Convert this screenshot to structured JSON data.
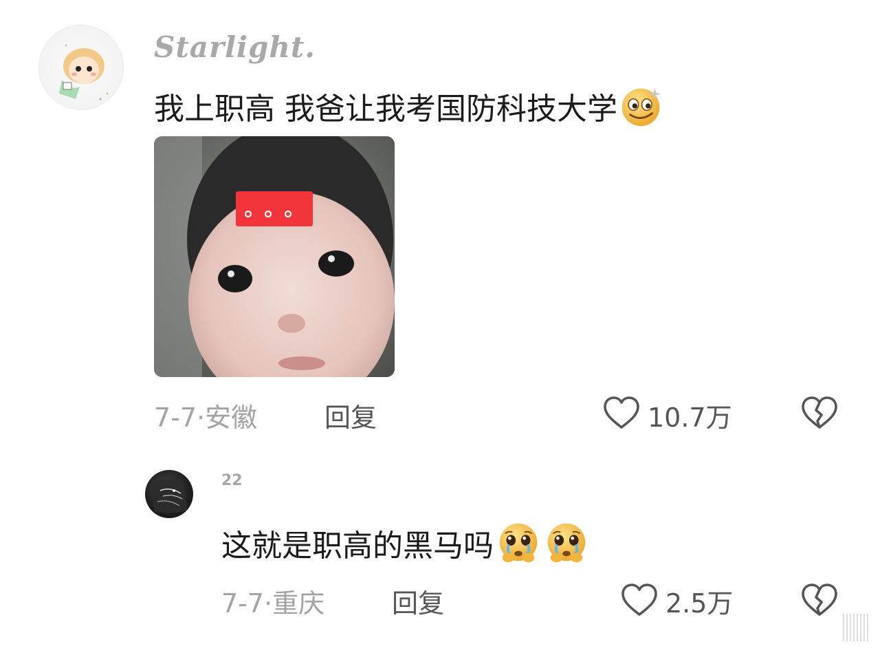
{
  "comment": {
    "username": "Starlight.",
    "text": "我上职高 我爸让我考国防科技大学",
    "emoji": "smiling-face-icon",
    "image": "baby-photo-with-dots-sticker",
    "date_location": "7-7·安徽",
    "reply_label": "回复",
    "likes": "10.7万"
  },
  "reply": {
    "username": "22",
    "text": "这就是职高的黑马吗",
    "emojis": [
      "pleading-face-icon",
      "pleading-face-icon"
    ],
    "date_location": "7-7·重庆",
    "reply_label": "回复",
    "likes": "2.5万"
  },
  "colors": {
    "sticker_red": "#f2353a",
    "muted_text": "#a3a3a3",
    "action_text": "#555555"
  }
}
